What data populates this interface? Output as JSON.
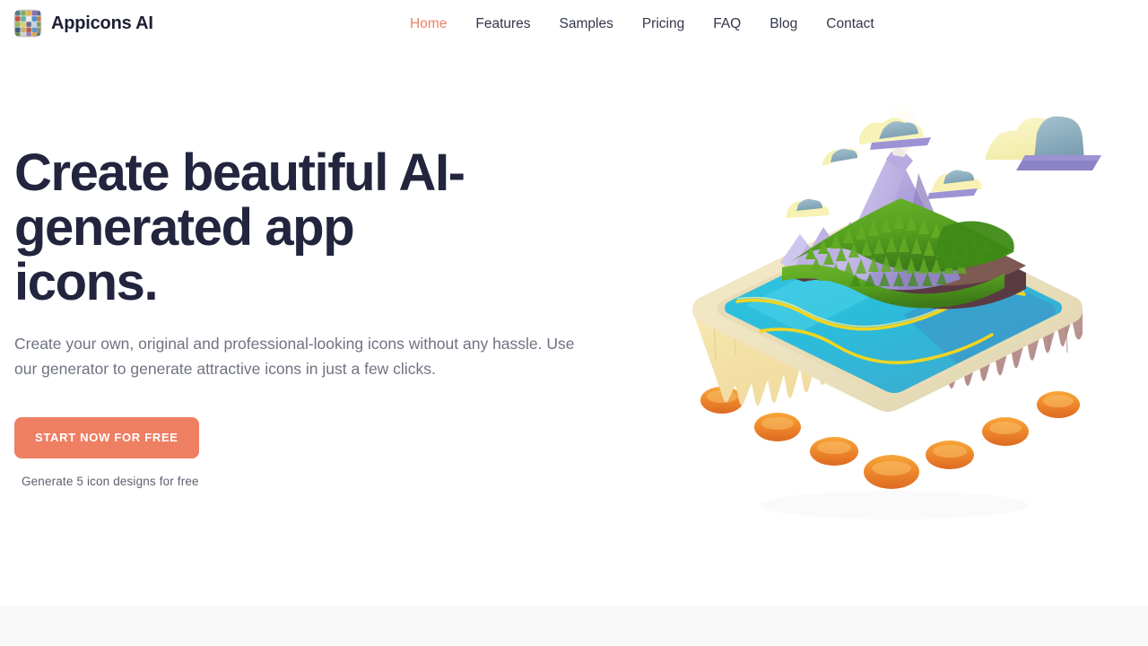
{
  "header": {
    "brand_name": "Appicons AI",
    "brand_logo_icon": "app-icon-grid-mosaic",
    "nav": [
      {
        "label": "Home",
        "active": true
      },
      {
        "label": "Features",
        "active": false
      },
      {
        "label": "Samples",
        "active": false
      },
      {
        "label": "Pricing",
        "active": false
      },
      {
        "label": "FAQ",
        "active": false
      },
      {
        "label": "Blog",
        "active": false
      },
      {
        "label": "Contact",
        "active": false
      }
    ]
  },
  "hero": {
    "title": "Create beautiful AI-generated app icons.",
    "subtitle": "Create your own, original and professional-looking icons without any hassle. Use our generator to generate attractive icons in just a few clicks.",
    "cta_label": "START NOW FOR FREE",
    "cta_note": "Generate 5 icon designs for free",
    "illustration_name": "isometric-3d-volcano-island-diorama"
  },
  "colors": {
    "accent": "#ee7f63",
    "nav_active": "#ea8164",
    "heading": "#22253d",
    "body_text": "#6f7381",
    "nav_text": "#32364b",
    "page_background": "#ffffff",
    "next_section_background": "#f8f8f9",
    "art_water": "#2fc1dd",
    "art_forest": "#4f9a22",
    "art_volcano": "#a79ad6",
    "art_base_left": "#f6e9b6",
    "art_base_right": "#c2a09b",
    "art_lava": "#ef8c2a",
    "art_sand": "#f6c389",
    "art_cloud_yellow": "#f7f2b4",
    "art_cloud_blue": "#8fb0c0"
  }
}
